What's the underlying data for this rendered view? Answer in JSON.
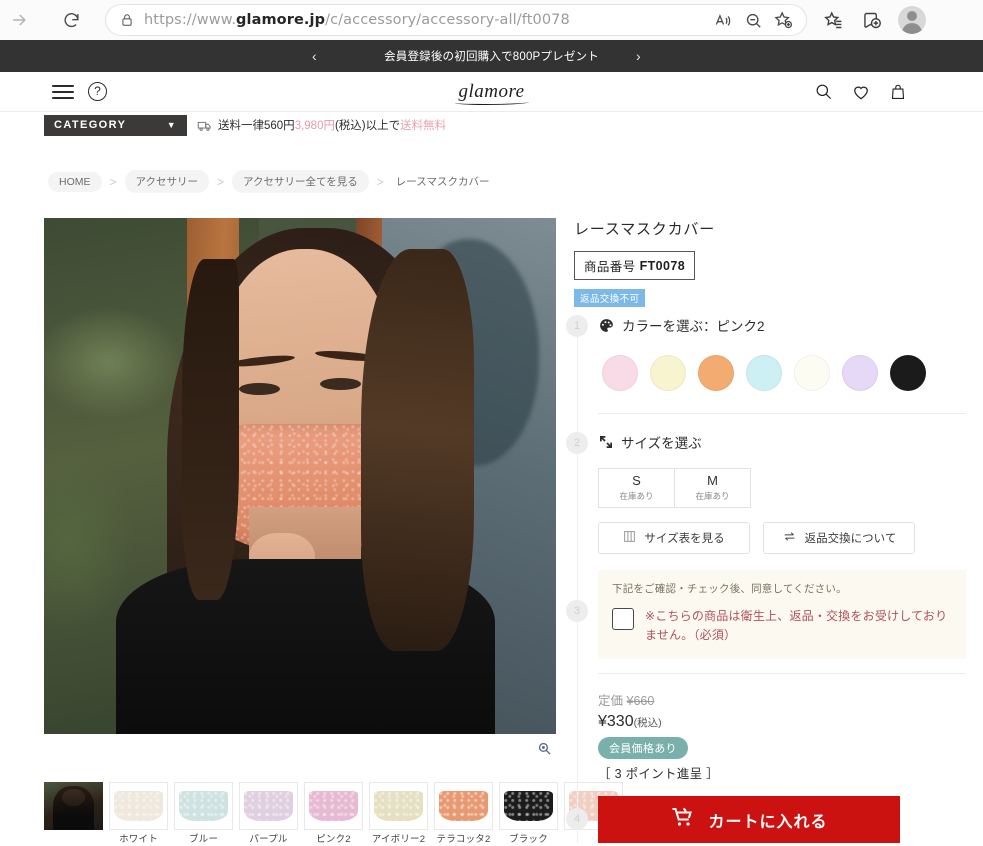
{
  "browser": {
    "url_prefix": "https://www.",
    "url_domain": "glamore.jp",
    "url_path": "/c/accessory/accessory-all/ft0078",
    "icons": {
      "forward": "forward-arrow-icon",
      "reload": "reload-icon",
      "lock": "lock-icon",
      "read_aloud": "read-aloud-icon",
      "zoom_out": "zoom-out-icon",
      "add_favorite": "add-favorite-icon",
      "favorites": "favorites-icon",
      "collections": "collections-icon",
      "profile": "profile-avatar-icon"
    }
  },
  "promo": {
    "text": "会員登録後の初回購入で800Pプレゼント",
    "prev": "‹",
    "next": "›"
  },
  "header": {
    "brand": "glamore",
    "menu_icon": "hamburger-menu-icon",
    "help_icon": "help-question-icon",
    "help_glyph": "?",
    "search_icon": "search-icon",
    "wishlist_icon": "heart-icon",
    "cart_icon": "shopping-bag-icon"
  },
  "category_strip": {
    "button_label": "CATEGORY",
    "chevron": "▼",
    "shipping_icon": "shipping-truck-icon",
    "shipping_prefix": "送料一律560円",
    "shipping_amount": "3,980円",
    "shipping_middle": "(税込)以上で",
    "shipping_free": "送料無料"
  },
  "breadcrumbs": {
    "separator": ">",
    "items": [
      {
        "label": "HOME"
      },
      {
        "label": "アクセサリー"
      },
      {
        "label": "アクセサリー全てを見る"
      },
      {
        "label": "レースマスクカバー"
      }
    ]
  },
  "gallery": {
    "zoom_icon": "magnify-zoom-icon",
    "thumbnails": [
      {
        "label": "",
        "color": "#3a3226",
        "name": "model-photo"
      },
      {
        "label": "ホワイト",
        "color": "#efe8dc"
      },
      {
        "label": "ブルー",
        "color": "#cfe2e2"
      },
      {
        "label": "パープル",
        "color": "#e0cfe0"
      },
      {
        "label": "ピンク2",
        "color": "#e7b9d2"
      },
      {
        "label": "アイボリー2",
        "color": "#e5e0c2"
      },
      {
        "label": "テラコッタ2",
        "color": "#e79a72"
      },
      {
        "label": "ブラック",
        "color": "#1c1c1c"
      },
      {
        "label": "",
        "color": "#f0cfc2",
        "name": "extra-swatch"
      }
    ]
  },
  "product": {
    "title": "レースマスクカバー",
    "sku_label": "商品番号",
    "sku_value": "FT0078",
    "badge": "返品交換不可"
  },
  "color_step": {
    "number": "1",
    "icon": "color-palette-icon",
    "label": "カラーを選ぶ：ピンク2",
    "swatches": [
      {
        "name": "pink",
        "color": "#f9dbe8"
      },
      {
        "name": "pale-yellow",
        "color": "#f7f4cf"
      },
      {
        "name": "terracotta",
        "color": "#f2ac72"
      },
      {
        "name": "light-blue",
        "color": "#ccf0f4"
      },
      {
        "name": "ivory",
        "color": "#fdfcf2"
      },
      {
        "name": "lavender",
        "color": "#e6d8f7"
      },
      {
        "name": "black",
        "color": "#1b1b1b"
      }
    ]
  },
  "size_step": {
    "number": "2",
    "icon": "resize-arrows-icon",
    "label": "サイズを選ぶ",
    "options": [
      {
        "size": "S",
        "stock": "在庫あり"
      },
      {
        "size": "M",
        "stock": "在庫あり"
      }
    ],
    "size_chart_button": "サイズ表を見る",
    "size_chart_icon": "table-grid-icon",
    "returns_button": "返品交換について",
    "returns_icon": "exchange-arrows-icon"
  },
  "agree_step": {
    "number": "3",
    "lead": "下記をご確認・チェック後、同意してください。",
    "text": "※こちらの商品は衛生上、返品・交換をお受けしておりません。（必須）"
  },
  "price": {
    "list_label": "定価",
    "list_value": "¥660",
    "current": "¥330",
    "tax_note": "(税込)",
    "member_badge": "会員価格あり",
    "points": "［ 3 ポイント進呈 ］"
  },
  "cart": {
    "number": "4",
    "icon": "shopping-cart-icon",
    "label": "カートに入れる",
    "color": "#cc1111"
  }
}
